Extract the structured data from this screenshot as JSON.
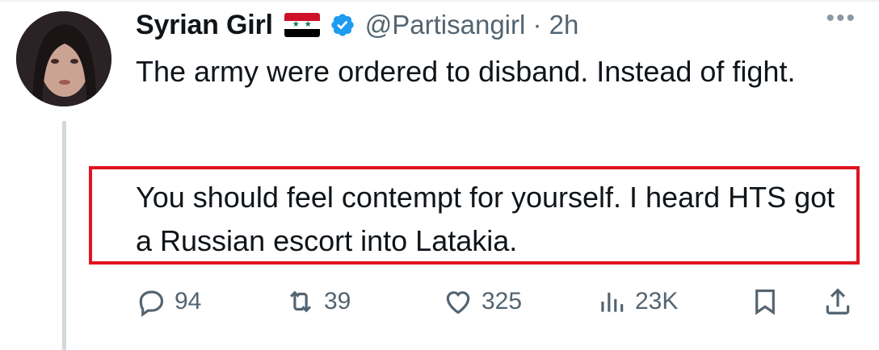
{
  "tweet": {
    "display_name": "Syrian Girl",
    "handle_time": "@Partisangirl · 2h",
    "text_line1": "The army were ordered to disband. Instead of fight.",
    "text_line2": "You should feel contempt for yourself. I heard HTS got a Russian escort into Latakia."
  },
  "actions": {
    "replies": "94",
    "retweets": "39",
    "likes": "325",
    "views": "23K"
  },
  "icons": {
    "reply": "reply-icon",
    "retweet": "retweet-icon",
    "like": "heart-icon",
    "views": "views-icon",
    "bookmark": "bookmark-icon",
    "share": "share-icon",
    "more": "more-icon",
    "verified": "verified-badge-icon",
    "flag": "syria-flag-icon"
  },
  "colors": {
    "highlight_border": "#e0141e",
    "muted_text": "#536471",
    "verified_blue": "#1d9bf0"
  }
}
